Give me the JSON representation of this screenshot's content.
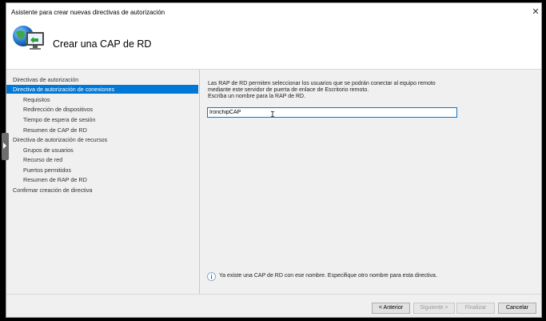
{
  "window": {
    "title": "Asistente para crear nuevas directivas de autorización"
  },
  "header": {
    "title": "Crear una CAP de RD",
    "icon": "remote-desktop-globe-icon"
  },
  "nav": {
    "items": [
      {
        "label": "Directivas de autorización",
        "level": 0,
        "selected": false
      },
      {
        "label": "Directiva de autorización de conexiones",
        "level": 0,
        "selected": true
      },
      {
        "label": "Requisitos",
        "level": 1,
        "selected": false
      },
      {
        "label": "Redirección de dispositivos",
        "level": 1,
        "selected": false
      },
      {
        "label": "Tiempo de espera de sesión",
        "level": 1,
        "selected": false
      },
      {
        "label": "Resumen de CAP de RD",
        "level": 1,
        "selected": false
      },
      {
        "label": "Directiva de autorización de recursos",
        "level": 0,
        "selected": false
      },
      {
        "label": "Grupos de usuarios",
        "level": 1,
        "selected": false
      },
      {
        "label": "Recurso de red",
        "level": 1,
        "selected": false
      },
      {
        "label": "Puertos permitidos",
        "level": 1,
        "selected": false
      },
      {
        "label": "Resumen de RAP de RD",
        "level": 1,
        "selected": false
      },
      {
        "label": "Confirmar creación de directiva",
        "level": 0,
        "selected": false
      }
    ]
  },
  "content": {
    "description_1": "Las RAP de RD permiten seleccionar los usuarios que se podrán conectar al equipo remoto",
    "description_2": "mediante este servidor de puerta de enlace de Escritorio remoto.",
    "description_3": "Escriba un nombre para la RAP de RD.",
    "name_value": "IronchipCAP",
    "info_message": "Ya existe una CAP de RD con ese nombre. Especifique otro nombre para esta directiva."
  },
  "footer": {
    "back_label": "< Anterior",
    "next_label": "Siguiente >",
    "finish_label": "Finalizar",
    "cancel_label": "Cancelar"
  },
  "colors": {
    "accent": "#0078d7",
    "panel_bg": "#f0f0f0"
  }
}
